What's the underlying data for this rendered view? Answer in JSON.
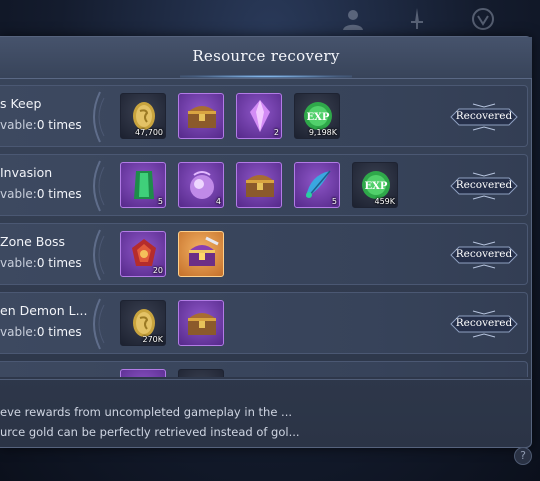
{
  "dialog": {
    "title": "Resource recovery"
  },
  "rows": [
    {
      "name": "s Keep",
      "available_label": "vable:",
      "available_count": "0 times",
      "button_label": "Recovered",
      "items": [
        {
          "icon": "gold-coin-icon",
          "rarity": "dark",
          "qty": "47,700"
        },
        {
          "icon": "treasure-chest-icon",
          "rarity": "purple",
          "qty": ""
        },
        {
          "icon": "purple-crystal-icon",
          "rarity": "purple",
          "qty": "2"
        },
        {
          "icon": "exp-orb-icon",
          "rarity": "dark",
          "qty": "9,198K"
        }
      ]
    },
    {
      "name": "Invasion",
      "available_label": "vable:",
      "available_count": "0 times",
      "button_label": "Recovered",
      "items": [
        {
          "icon": "green-gem-icon",
          "rarity": "purple",
          "qty": "5"
        },
        {
          "icon": "purple-orb-icon",
          "rarity": "purple",
          "qty": "4"
        },
        {
          "icon": "treasure-chest-icon",
          "rarity": "purple",
          "qty": ""
        },
        {
          "icon": "feather-quill-icon",
          "rarity": "purple",
          "qty": "5"
        },
        {
          "icon": "exp-orb-icon",
          "rarity": "dark",
          "qty": "459K"
        }
      ]
    },
    {
      "name": "Zone Boss",
      "available_label": "vable:",
      "available_count": "0 times",
      "button_label": "Recovered",
      "items": [
        {
          "icon": "red-emblem-icon",
          "rarity": "purple",
          "qty": "20"
        },
        {
          "icon": "ornate-chest-icon",
          "rarity": "orange",
          "qty": ""
        }
      ]
    },
    {
      "name": "en Demon L...",
      "available_label": "vable:",
      "available_count": "0 times",
      "button_label": "Recovered",
      "items": [
        {
          "icon": "gold-coin-icon",
          "rarity": "dark",
          "qty": "270K"
        },
        {
          "icon": "treasure-chest-icon",
          "rarity": "purple",
          "qty": ""
        }
      ]
    }
  ],
  "footer": {
    "line1": "eve rewards from uncompleted gameplay in the ...",
    "line2": "urce gold can be perfectly retrieved instead of gol..."
  },
  "help": {
    "label": "?"
  }
}
